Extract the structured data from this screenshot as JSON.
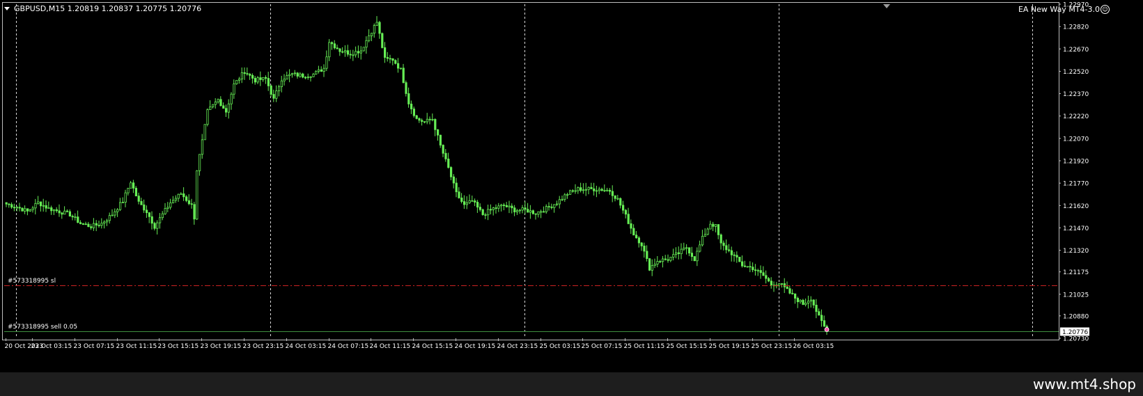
{
  "window": {
    "symbol_header": "GBPUSD,M15  1.20819 1.20837 1.20775 1.20776",
    "ea_label": "EA New Way MT4-3.0",
    "watermark": "www.mt4.shop"
  },
  "colors": {
    "background": "#000000",
    "candle": "#66ee55",
    "grid": "#d8d8d8",
    "axis_text": "#ffffff",
    "sl_line": "#cc2222",
    "order_line": "#3f8f3f",
    "price_tag_bg": "#ffffff"
  },
  "orders": {
    "sl_label": "#573318995 sl",
    "sl_price": 1.21085,
    "order_label": "#573318995 sell 0.05",
    "order_price": 1.20776,
    "current_price_tag": "1.20776"
  },
  "chart_data": {
    "type": "candlestick",
    "symbol": "GBPUSD",
    "timeframe": "M15",
    "ylim": [
      1.2073,
      1.2297
    ],
    "y_ticks": [
      "1.22970",
      "1.22820",
      "1.22670",
      "1.22520",
      "1.22370",
      "1.22220",
      "1.22070",
      "1.21920",
      "1.21770",
      "1.21620",
      "1.21470",
      "1.21320",
      "1.21175",
      "1.21025",
      "1.20880",
      "1.20730"
    ],
    "x_tick_labels": [
      "20 Oct 2023",
      "23 Oct 03:15",
      "23 Oct 07:15",
      "23 Oct 11:15",
      "23 Oct 15:15",
      "23 Oct 19:15",
      "23 Oct 23:15",
      "24 Oct 03:15",
      "24 Oct 07:15",
      "24 Oct 11:15",
      "24 Oct 15:15",
      "24 Oct 19:15",
      "24 Oct 23:15",
      "25 Oct 03:15",
      "25 Oct 07:15",
      "25 Oct 11:15",
      "25 Oct 15:15",
      "25 Oct 19:15",
      "25 Oct 23:15",
      "26 Oct 03:15"
    ],
    "x_tick_positions": [
      0,
      10,
      26,
      42,
      58,
      74,
      90,
      106,
      122,
      138,
      154,
      170,
      186,
      202,
      218,
      234,
      250,
      266,
      282,
      298
    ],
    "last_bar_index": 310,
    "grid": true,
    "grid_x_bar_index": [
      4,
      100,
      196,
      292,
      388
    ],
    "series": [
      {
        "name": "GBPUSD,M15",
        "close_path": [
          [
            0,
            1.2163
          ],
          [
            4,
            1.2161
          ],
          [
            8,
            1.2158
          ],
          [
            12,
            1.2164
          ],
          [
            16,
            1.216
          ],
          [
            20,
            1.2158
          ],
          [
            24,
            1.2156
          ],
          [
            28,
            1.215
          ],
          [
            32,
            1.2148
          ],
          [
            36,
            1.215
          ],
          [
            40,
            1.2156
          ],
          [
            44,
            1.2165
          ],
          [
            47,
            1.2178
          ],
          [
            50,
            1.2164
          ],
          [
            53,
            1.2158
          ],
          [
            56,
            1.2148
          ],
          [
            59,
            1.2156
          ],
          [
            62,
            1.2164
          ],
          [
            66,
            1.217
          ],
          [
            70,
            1.2162
          ],
          [
            71,
            1.2154
          ],
          [
            72,
            1.2186
          ],
          [
            74,
            1.2205
          ],
          [
            76,
            1.2225
          ],
          [
            80,
            1.2233
          ],
          [
            83,
            1.2225
          ],
          [
            86,
            1.2243
          ],
          [
            90,
            1.2252
          ],
          [
            94,
            1.2246
          ],
          [
            98,
            1.2247
          ],
          [
            101,
            1.2233
          ],
          [
            104,
            1.2247
          ],
          [
            108,
            1.225
          ],
          [
            112,
            1.2249
          ],
          [
            116,
            1.225
          ],
          [
            120,
            1.2254
          ],
          [
            122,
            1.2272
          ],
          [
            126,
            1.2266
          ],
          [
            130,
            1.2264
          ],
          [
            134,
            1.2266
          ],
          [
            137,
            1.2276
          ],
          [
            140,
            1.2285
          ],
          [
            143,
            1.226
          ],
          [
            146,
            1.226
          ],
          [
            149,
            1.2253
          ],
          [
            152,
            1.2231
          ],
          [
            155,
            1.222
          ],
          [
            158,
            1.2218
          ],
          [
            161,
            1.222
          ],
          [
            164,
            1.2202
          ],
          [
            167,
            1.2187
          ],
          [
            170,
            1.217
          ],
          [
            173,
            1.2162
          ],
          [
            176,
            1.2165
          ],
          [
            180,
            1.2156
          ],
          [
            184,
            1.216
          ],
          [
            188,
            1.2162
          ],
          [
            192,
            1.2159
          ],
          [
            196,
            1.2159
          ],
          [
            200,
            1.2157
          ],
          [
            204,
            1.216
          ],
          [
            208,
            1.2164
          ],
          [
            212,
            1.217
          ],
          [
            216,
            1.2173
          ],
          [
            220,
            1.2173
          ],
          [
            224,
            1.2173
          ],
          [
            228,
            1.2172
          ],
          [
            231,
            1.2166
          ],
          [
            234,
            1.2155
          ],
          [
            237,
            1.2143
          ],
          [
            240,
            1.2136
          ],
          [
            243,
            1.212
          ],
          [
            246,
            1.2125
          ],
          [
            250,
            1.2126
          ],
          [
            254,
            1.213
          ],
          [
            257,
            1.2134
          ],
          [
            260,
            1.2126
          ],
          [
            263,
            1.214
          ],
          [
            266,
            1.215
          ],
          [
            268,
            1.2148
          ],
          [
            270,
            1.2136
          ],
          [
            274,
            1.213
          ],
          [
            278,
            1.2122
          ],
          [
            282,
            1.212
          ],
          [
            286,
            1.2115
          ],
          [
            289,
            1.2109
          ],
          [
            292,
            1.211
          ],
          [
            295,
            1.2105
          ],
          [
            298,
            1.21
          ],
          [
            301,
            1.2096
          ],
          [
            304,
            1.21
          ],
          [
            307,
            1.2087
          ],
          [
            310,
            1.20776
          ]
        ]
      }
    ]
  }
}
